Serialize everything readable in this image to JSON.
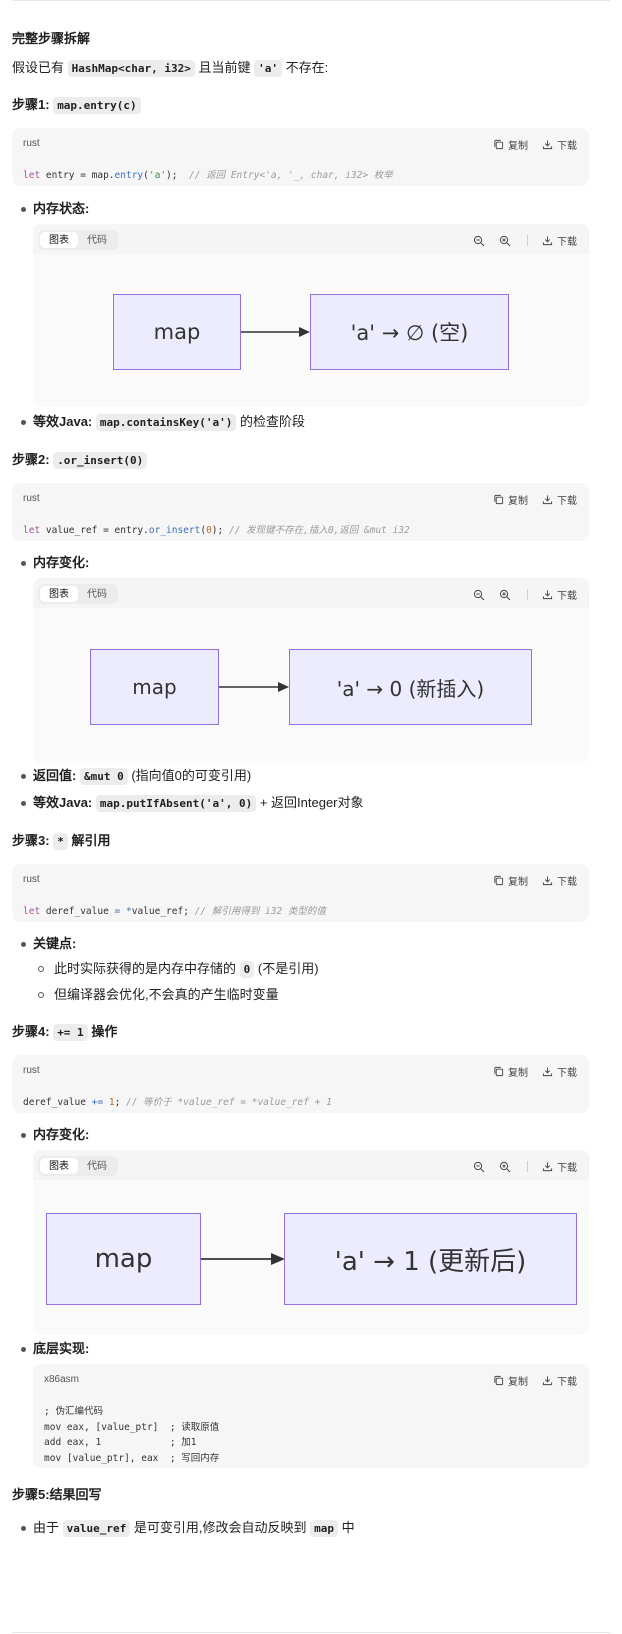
{
  "heading": "完整步骤拆解",
  "intro": {
    "pre": "假设已有",
    "code1": "HashMap<char, i32>",
    "mid": "且当前键",
    "code2": "'a'",
    "post": "不存在:"
  },
  "actions": {
    "copy": "复制",
    "download": "下载"
  },
  "tabs": {
    "chart": "图表",
    "code": "代码"
  },
  "step1": {
    "label": "步骤1:",
    "code": "map.entry(c)",
    "lang": "rust",
    "line": {
      "a": "let",
      "b": " entry = map.",
      "c": "entry",
      "d": "(",
      "e": "'a'",
      "f": ");  ",
      "g": "// 返回 Entry<'a, '_, char, i32> 枚举"
    },
    "mem_label": "内存状态:",
    "diagram": {
      "left": "map",
      "right": "'a' → ∅ (空)"
    },
    "equiv": {
      "label": "等效Java:",
      "code": "map.containsKey('a')",
      "post": "的检查阶段"
    }
  },
  "step2": {
    "label": "步骤2:",
    "code": ".or_insert(0)",
    "lang": "rust",
    "line": {
      "a": "let",
      "b": " value_ref = entry.",
      "c": "or_insert",
      "d": "(",
      "e": "0",
      "f": "); ",
      "g": "// 发现键不存在,插入0,返回 &mut i32"
    },
    "mem_label": "内存变化:",
    "diagram": {
      "left": "map",
      "right": "'a' → 0 (新插入)"
    },
    "ret": {
      "label": "返回值:",
      "code": "&mut 0",
      "post": "(指向值0的可变引用)"
    },
    "equiv": {
      "label": "等效Java:",
      "code": "map.putIfAbsent('a', 0)",
      "post": "+ 返回Integer对象"
    }
  },
  "step3": {
    "label": "步骤3:",
    "code": "*",
    "post": "解引用",
    "lang": "rust",
    "line": {
      "a": "let",
      "b": " deref_value ",
      "c": "=",
      "d": " ",
      "e": "*",
      "f": "value_ref; ",
      "g": "// 解引用得到 i32 类型的值"
    },
    "key_label": "关键点:",
    "sub1": {
      "pre": "此时实际获得的是内存中存储的",
      "code": "0",
      "post": "(不是引用)"
    },
    "sub2": "但编译器会优化,不会真的产生临时变量"
  },
  "step4": {
    "label": "步骤4:",
    "code": "+= 1",
    "post": "操作",
    "lang": "rust",
    "line": {
      "a": "deref_value ",
      "b": "+=",
      "c": " ",
      "d": "1",
      "e": "; ",
      "f": "// 等价于 *value_ref = *value_ref + 1"
    },
    "mem_label": "内存变化:",
    "diagram": {
      "left": "map",
      "right": "'a' → 1 (更新后)"
    },
    "impl_label": "底层实现:",
    "asm_lang": "x86asm",
    "asm": [
      "; 伪汇编代码",
      "mov eax, [value_ptr]  ; 读取原值",
      "add eax, 1            ; 加1",
      "mov [value_ptr], eax  ; 写回内存"
    ]
  },
  "step5": {
    "label": "步骤5:结果回写",
    "item": {
      "pre": "由于",
      "code": "value_ref",
      "mid": "是可变引用,修改会自动反映到",
      "code2": "map",
      "post": "中"
    }
  }
}
